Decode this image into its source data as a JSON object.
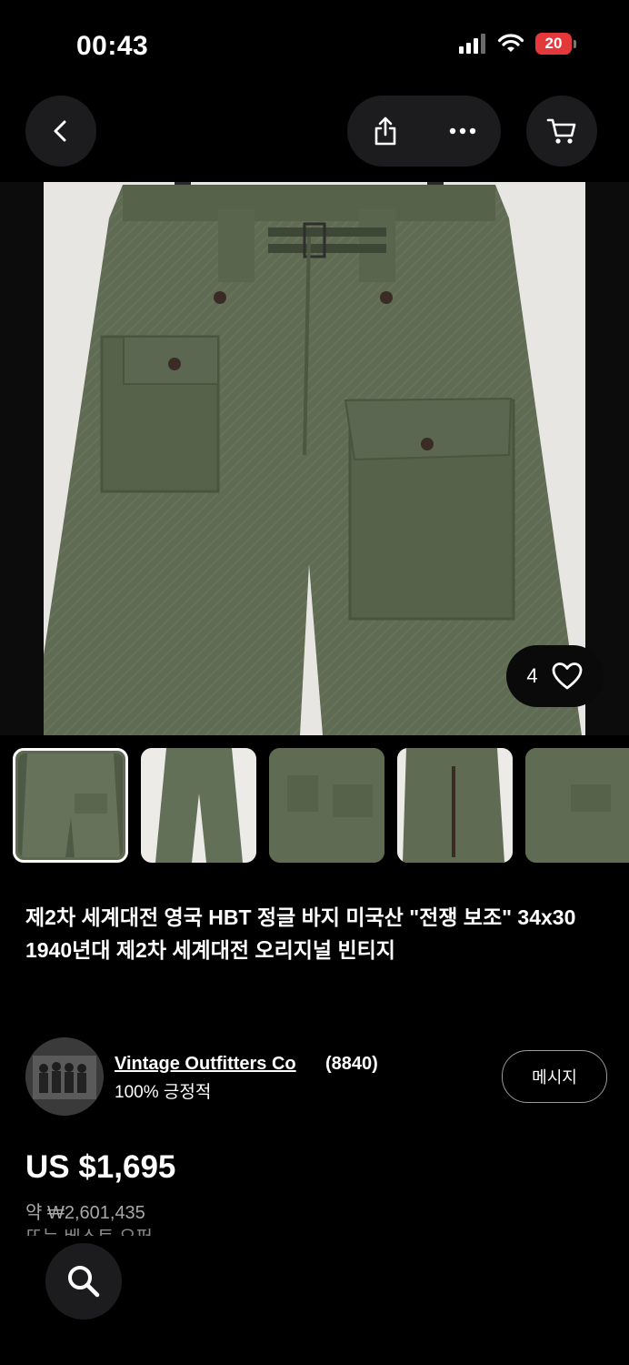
{
  "status_bar": {
    "time": "00:43",
    "battery": "20"
  },
  "nav": {
    "back_icon": "chevron-left-icon",
    "share_icon": "share-icon",
    "more_icon": "more-horizontal-icon",
    "cart_icon": "cart-icon"
  },
  "gallery": {
    "like_count": "4",
    "like_icon": "heart-outline-icon",
    "thumbnails": [
      "thumb-1",
      "thumb-2",
      "thumb-3",
      "thumb-4",
      "thumb-5"
    ],
    "selected_index": 0
  },
  "listing": {
    "title": "제2차 세계대전 영국 HBT 정글 바지 미국산 \"전쟁 보조\" 34x30 1940년대 제2차 세계대전 오리지널 빈티지",
    "price": "US $1,695",
    "approx_price": "약 ₩2,601,435",
    "next_line": "또는 베스트 오퍼"
  },
  "seller": {
    "name": "Vintage Outfitters Co",
    "feedback_count": "(8840)",
    "feedback": "100% 긍정적",
    "message_label": "메시지"
  },
  "bottom": {
    "search_icon": "search-icon"
  },
  "colors": {
    "background": "#000000",
    "button_bg": "#1c1c1e",
    "olive": "#5d6a51",
    "battery": "#e5383b"
  }
}
